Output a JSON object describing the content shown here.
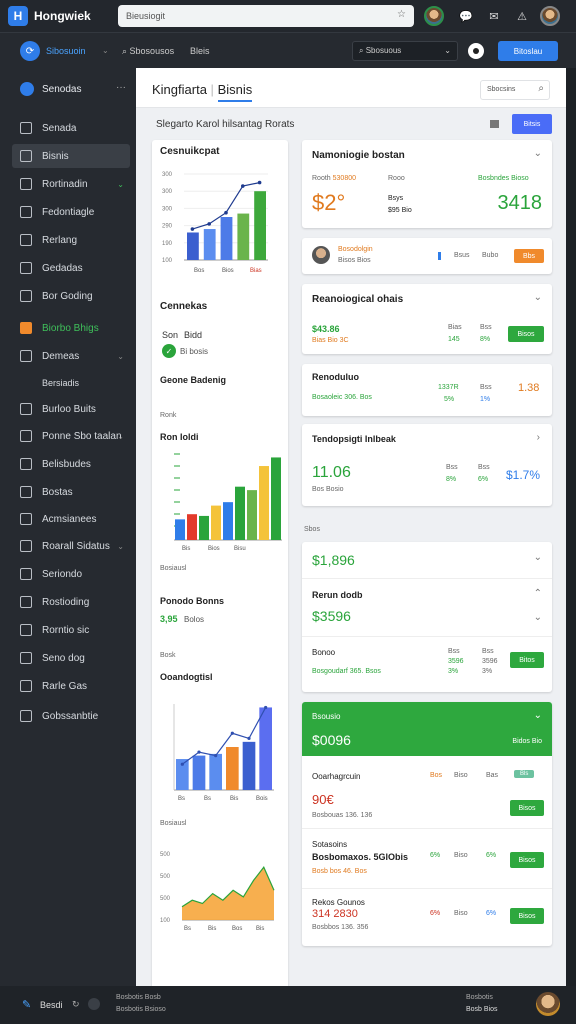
{
  "app": {
    "name": "Hongwiek",
    "search_placeholder": "Bieusiogit"
  },
  "topbar": {
    "brand": "Sibosuoin",
    "crumb": "Sbosousos",
    "crumb2": "Bleis",
    "search_placeholder": "Sbosuous",
    "action_label": "Bitoslau"
  },
  "sidebar": {
    "header": "Senodas",
    "items": [
      {
        "label": "Senada"
      },
      {
        "label": "Bisnis"
      },
      {
        "label": "Rortinadin"
      },
      {
        "label": "Fedontiagle"
      },
      {
        "label": "Rerlang"
      },
      {
        "label": "Gedadas"
      },
      {
        "label": "Bor Goding"
      },
      {
        "label": "Biorbo Bhigs"
      },
      {
        "label": "Demeas"
      },
      {
        "label": "Bersiadis"
      },
      {
        "label": "Burloo Buits"
      },
      {
        "label": "Ponne Sbo taalan"
      },
      {
        "label": "Belisbudes"
      },
      {
        "label": "Bostas"
      },
      {
        "label": "Acmsianees"
      },
      {
        "label": "Roarall Sidatus"
      },
      {
        "label": "Seriondo"
      },
      {
        "label": "Rostioding"
      },
      {
        "label": "Rorntio sic"
      },
      {
        "label": "Seno dog"
      },
      {
        "label": "Rarle Gas"
      },
      {
        "label": "Gobssanbtie"
      }
    ]
  },
  "main": {
    "title": "Kingfiarta",
    "title2": "Bisnis",
    "filter_label": "Sbocsins",
    "subtitle": "Slegarto Karol hilsantag Rorats",
    "subtitle_btn": "Bitsis"
  },
  "left": {
    "chart1_title": "Cesnuikcpat",
    "chart1_ticks": [
      "300",
      "300",
      "300",
      "290",
      "190",
      "100"
    ],
    "chart1_x": [
      "Bos",
      "Bios",
      "Bias"
    ],
    "chart1": {
      "type": "bar",
      "values": [
        32,
        36,
        50,
        54,
        80
      ],
      "line": [
        36,
        42,
        55,
        86,
        90
      ],
      "colors": [
        "#3b5fcf",
        "#5b8def",
        "#4d7be8",
        "#6ab44b",
        "#3da83b"
      ]
    },
    "sec_title": "Cennekas",
    "stat1_label": "Son",
    "stat1_value": "Bidd",
    "stat2": "Bi bosis",
    "chart2_head": "Geone Badenig",
    "chart2_sub": "Ronk",
    "chart2_label": "Ron Ioldi",
    "chart2_x": [
      "Bis",
      "Bios",
      "Bisu"
    ],
    "chart2": {
      "type": "bar",
      "values": [
        24,
        30,
        28,
        40,
        44,
        62,
        58,
        86,
        96
      ],
      "colors": [
        "#2f7de9",
        "#e33a2b",
        "#2aa43b",
        "#f4c33a",
        "#2f7de9",
        "#2aa43b",
        "#6ab44b",
        "#f4c33a",
        "#2aa43b"
      ]
    },
    "chart2_foot": "Bosiausl",
    "small_head": "Ponodo Bonns",
    "small_value": "3,95",
    "small_sub": "Bolos",
    "small_foot": "Bosk",
    "chart3_title": "Ooandogtisl",
    "chart3_x": [
      "Bs",
      "Bs",
      "Bis",
      "Bois"
    ],
    "chart3": {
      "type": "bar",
      "values": [
        36,
        40,
        42,
        50,
        56,
        96
      ],
      "line": [
        30,
        44,
        40,
        66,
        60,
        96
      ],
      "colors": [
        "#5b8def",
        "#4d7be8",
        "#5b8def",
        "#f08a2c",
        "#3b5fcf",
        "#5b6ef0"
      ]
    },
    "chart3_foot": "Bosiausl",
    "chart4_ticks": [
      "500",
      "500",
      "500",
      "100"
    ],
    "chart4_x": [
      "Bs",
      "Bis",
      "Bos",
      "Bis"
    ],
    "chart4": {
      "type": "area",
      "values": [
        20,
        30,
        25,
        40,
        30,
        45,
        35,
        60,
        80,
        45
      ],
      "colors": [
        "#f6a63c",
        "#e8922e"
      ]
    }
  },
  "right": {
    "card1": {
      "title": "Namoniogie bostan",
      "sub1": "Rooth",
      "sub1b": "530800",
      "sub2": "Rooo",
      "sub3": "Bosbndes",
      "sub3b": "Bioso",
      "big": "$2°",
      "mid1": "Bsys",
      "mid2": "$95 Bio",
      "big2": "3418"
    },
    "card2": {
      "name": "Bosodolgin",
      "meta": "Bisos Bios",
      "col1": "Bsus",
      "col2": "Bubo",
      "btn": "Bbs"
    },
    "card3": {
      "title": "Reanoiogical ohais",
      "val": "$43.86",
      "sub": "Bias Bio 3C",
      "c1": "Bias",
      "c1b": "145",
      "c2": "Bss",
      "c2b": "8%",
      "btn": "Bisos"
    },
    "card4": {
      "title": "Renoduluo",
      "sub": "Bosaoleic 306. Bos",
      "c1": "1337R",
      "c1b": "5%",
      "c2": "Bss",
      "c2b": "1%",
      "val": "1.38"
    },
    "card5": {
      "title": "Tendopsigti Inlbeak",
      "big": "11.06",
      "sub": "Bos Bosio",
      "c1": "Bss",
      "c1b": "8%",
      "c2": "Bss",
      "c2b": "6%",
      "val": "$1.7%"
    },
    "section_label": "Sbos",
    "card6": {
      "big": "$1,896",
      "h2": "Rerun dodb",
      "big2": "$3596",
      "h3": "Bonoo",
      "sub": "Bosgoudarf 365. Bsos",
      "c1": "Bss",
      "c1b": "3596",
      "c1c": "3%",
      "c2": "Bss",
      "c2b": "3596",
      "c2c": "3%",
      "btn": "Bitos"
    },
    "card7": {
      "head": "Bsousio",
      "big": "$0096",
      "tag": "Bidos Bio",
      "row1": {
        "title": "Ooarhagrcuin",
        "big": "90€",
        "sub": "Bosbouas 136. 136",
        "c1": "Bos",
        "c2": "Biso",
        "c3": "Bas",
        "tag": "Bls",
        "btn": "Bisos"
      },
      "row2": {
        "title": "Sotasoins",
        "sub2": "Bosbomaxos. 5GlObis",
        "sub": "Bosb bos 46. Bos",
        "c1": "6%",
        "c2": "Biso",
        "c3": "6%",
        "btn": "Bisos"
      },
      "row3": {
        "title": "Rekos Gounos",
        "big": "314 2830",
        "sub": "Bosbbos 136. 356",
        "c1": "6%",
        "c2": "Biso",
        "c3": "6%",
        "btn": "Bisos"
      }
    }
  },
  "footer": {
    "label": "Besdi",
    "meta": "Bosbotis Bosb",
    "line2": "Bosbotis Bsioso",
    "right": "Bosbotis",
    "right2": "Bosb Bios"
  }
}
